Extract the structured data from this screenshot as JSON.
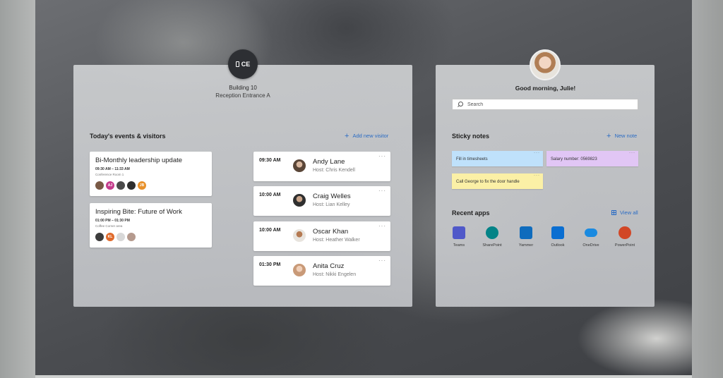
{
  "location": {
    "badge_text": "CE",
    "building": "Building 10",
    "entrance": "Reception Entrance A"
  },
  "events_section": {
    "title": "Today's events & visitors",
    "add_visitor_label": "Add new visitor"
  },
  "events": [
    {
      "title": "Bi-Monthly leadership update",
      "time": "09:30 AM – 11:33 AM",
      "location": "Conference Room 1",
      "attendees": [
        {
          "initials": "",
          "color": "#7a5a46"
        },
        {
          "initials": "AJ",
          "color": "#c43c8c"
        },
        {
          "initials": "",
          "color": "#4b4b4b"
        },
        {
          "initials": "",
          "color": "#2e2e2e"
        },
        {
          "initials": "JB",
          "color": "#e8912b"
        }
      ]
    },
    {
      "title": "Inspiring Bite: Future of Work",
      "time": "01:00 PM – 01:30 PM",
      "location": "Coffee Corner area",
      "attendees": [
        {
          "initials": "",
          "color": "#3c3c3c"
        },
        {
          "initials": "KL",
          "color": "#e06a2b"
        },
        {
          "initials": "",
          "color": "#d8d8d8"
        },
        {
          "initials": "",
          "color": "#b59a8e"
        }
      ]
    }
  ],
  "visitors": [
    {
      "time": "09:30 AM",
      "name": "Andy Lane",
      "host": "Host: Chris Kendell",
      "photo_color": "#5a4638"
    },
    {
      "time": "10:00 AM",
      "name": "Craig Welles",
      "host": "Host: Lian Kelley",
      "photo_color": "#2f2f2f"
    },
    {
      "time": "10:00 AM",
      "name": "Oscar Khan",
      "host": "Host: Heather Walker",
      "photo_color": "#8a5a3a"
    },
    {
      "time": "01:30 PM",
      "name": "Anita Cruz",
      "host": "Host: Nikki Engelen",
      "photo_color": "#c99a78"
    }
  ],
  "profile": {
    "greeting": "Good morning, Julie!"
  },
  "search": {
    "placeholder": "Search"
  },
  "sticky_notes": {
    "title": "Sticky notes",
    "new_note_label": "New note",
    "notes": [
      {
        "text": "Fill in timesheets",
        "color": "#bfe1fb"
      },
      {
        "text": "Salary number: 0569823",
        "color": "#e1c6f5"
      },
      {
        "text": "Call George to fix the door handle",
        "color": "#fbf0a6"
      }
    ]
  },
  "recent_apps": {
    "title": "Recent apps",
    "view_all_label": "View all",
    "apps": [
      {
        "name": "Teams",
        "icon": "teams-icon",
        "color": "#5059c9"
      },
      {
        "name": "SharePoint",
        "icon": "sharepoint-icon",
        "color": "#038387"
      },
      {
        "name": "Yammer",
        "icon": "yammer-icon",
        "color": "#0f6cbd"
      },
      {
        "name": "Outlook",
        "icon": "outlook-icon",
        "color": "#0a6ed1"
      },
      {
        "name": "OneDrive",
        "icon": "onedrive-icon",
        "color": "#1a8ae0"
      },
      {
        "name": "PowerPoint",
        "icon": "powerpoint-icon",
        "color": "#d24726"
      }
    ]
  }
}
